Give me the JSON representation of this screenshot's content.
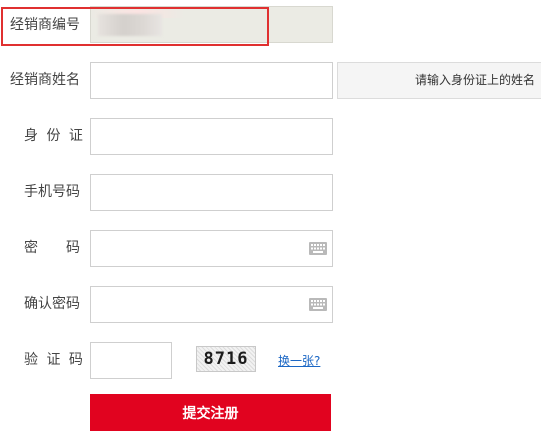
{
  "form": {
    "dealer_no": {
      "label": "经销商编号",
      "value": ""
    },
    "dealer_name": {
      "label": "经销商姓名",
      "value": "",
      "hint": "请输入身份证上的姓名"
    },
    "id_card": {
      "label": "身 份 证",
      "value": ""
    },
    "phone": {
      "label": "手机号码",
      "value": ""
    },
    "password": {
      "label": "密　　码",
      "value": "",
      "icon": "keyboard-icon"
    },
    "confirm_password": {
      "label": "确认密码",
      "value": "",
      "icon": "keyboard-icon"
    },
    "captcha": {
      "label": "验 证 码",
      "value": "",
      "image_text": "8716",
      "refresh_link": "换一张?"
    },
    "submit_label": "提交注册"
  },
  "colors": {
    "accent": "#e1031f",
    "highlight_border": "#e03030",
    "link": "#1a66c4"
  }
}
